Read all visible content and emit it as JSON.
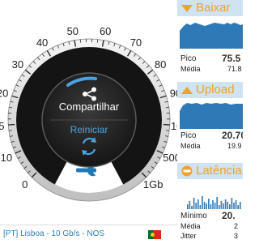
{
  "gauge": {
    "scale_labels": [
      "0",
      "10",
      "15",
      "20",
      "30",
      "40",
      "50",
      "60",
      "70",
      "80",
      "90",
      "100",
      "500",
      "1Gb"
    ],
    "share_label": "Compartilhar",
    "restart_label": "Reiniciar",
    "share_icon": "share-icon",
    "restart_icon": "refresh-icon",
    "settings_icon": "wrench-icon",
    "accent_color": "#4aa3e0"
  },
  "status": {
    "server": "[PT] Lisboa - 10 Gb/s - NOS",
    "flag_icon": "portugal-flag-icon"
  },
  "panels": {
    "download": {
      "title": "Baixar",
      "peak_label": "Pico",
      "peak_value": "75.5",
      "avg_label": "Média",
      "avg_value": "71.8"
    },
    "upload": {
      "title": "Upload",
      "peak_label": "Pico",
      "peak_value": "20.70",
      "avg_label": "Média",
      "avg_value": "19.9"
    },
    "latency": {
      "title": "Latência",
      "min_label": "Mínimo",
      "min_value": "20.",
      "avg_label": "Média",
      "avg_value": "2",
      "jitter_label": "Jitter",
      "jitter_value": "3"
    }
  }
}
